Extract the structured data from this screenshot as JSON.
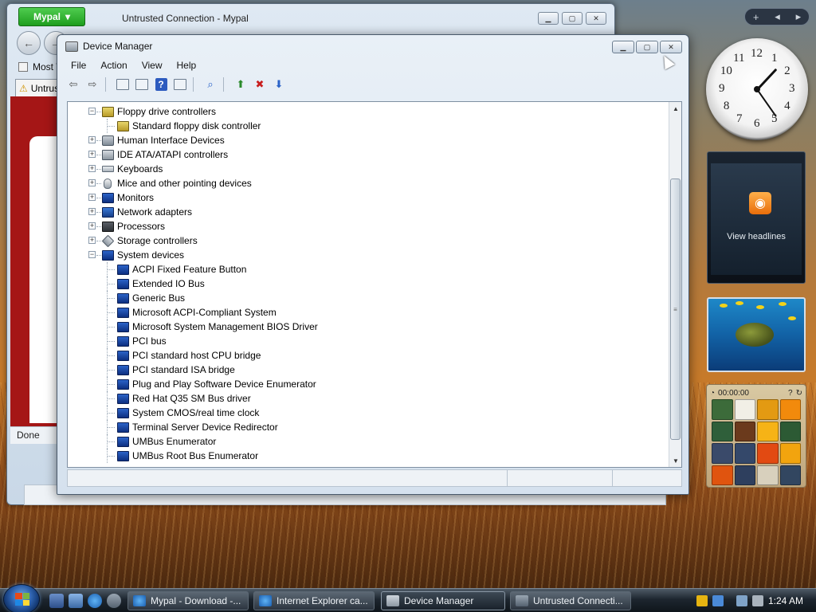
{
  "desktop": {
    "background_theme": "wheat-field"
  },
  "background_window": {
    "app_button": "Mypal",
    "title": "Untrusted Connection - Mypal",
    "bookmark": "Most V",
    "tab": "Untrus",
    "status": "Done"
  },
  "device_manager": {
    "title": "Device Manager",
    "menu": [
      "File",
      "Action",
      "View",
      "Help"
    ],
    "tree": [
      {
        "label": "Floppy drive controllers",
        "level": 0,
        "expanded": true,
        "icon": "floppy-controller-icon"
      },
      {
        "label": "Standard floppy disk controller",
        "level": 1,
        "icon": "floppy-controller-icon"
      },
      {
        "label": "Human Interface Devices",
        "level": 0,
        "expanded": false,
        "icon": "hid-icon"
      },
      {
        "label": "IDE ATA/ATAPI controllers",
        "level": 0,
        "expanded": false,
        "icon": "ide-icon"
      },
      {
        "label": "Keyboards",
        "level": 0,
        "expanded": false,
        "icon": "keyboard-icon"
      },
      {
        "label": "Mice and other pointing devices",
        "level": 0,
        "expanded": false,
        "icon": "mouse-icon"
      },
      {
        "label": "Monitors",
        "level": 0,
        "expanded": false,
        "icon": "monitor-icon"
      },
      {
        "label": "Network adapters",
        "level": 0,
        "expanded": false,
        "icon": "network-icon"
      },
      {
        "label": "Processors",
        "level": 0,
        "expanded": false,
        "icon": "processor-icon"
      },
      {
        "label": "Storage controllers",
        "level": 0,
        "expanded": false,
        "icon": "storage-icon"
      },
      {
        "label": "System devices",
        "level": 0,
        "expanded": true,
        "icon": "system-icon"
      },
      {
        "label": "ACPI Fixed Feature Button",
        "level": 1,
        "icon": "system-icon"
      },
      {
        "label": "Extended IO Bus",
        "level": 1,
        "icon": "system-icon"
      },
      {
        "label": "Generic Bus",
        "level": 1,
        "icon": "system-icon"
      },
      {
        "label": "Microsoft ACPI-Compliant System",
        "level": 1,
        "icon": "system-icon"
      },
      {
        "label": "Microsoft System Management BIOS Driver",
        "level": 1,
        "icon": "system-icon"
      },
      {
        "label": "PCI bus",
        "level": 1,
        "icon": "system-icon"
      },
      {
        "label": "PCI standard host CPU bridge",
        "level": 1,
        "icon": "system-icon"
      },
      {
        "label": "PCI standard ISA bridge",
        "level": 1,
        "icon": "system-icon"
      },
      {
        "label": "Plug and Play Software Device Enumerator",
        "level": 1,
        "icon": "system-icon"
      },
      {
        "label": "Red Hat Q35 SM Bus driver",
        "level": 1,
        "icon": "system-icon"
      },
      {
        "label": "System CMOS/real time clock",
        "level": 1,
        "icon": "system-icon"
      },
      {
        "label": "Terminal Server Device Redirector",
        "level": 1,
        "icon": "system-icon"
      },
      {
        "label": "UMBus Enumerator",
        "level": 1,
        "icon": "system-icon"
      },
      {
        "label": "UMBus Root Bus Enumerator",
        "level": 1,
        "icon": "system-icon"
      }
    ]
  },
  "sidebar": {
    "news_label": "View headlines",
    "timer": "00:00:00",
    "clock_numbers": [
      "12",
      "1",
      "2",
      "3",
      "4",
      "5",
      "6",
      "7",
      "8",
      "9",
      "10",
      "11"
    ]
  },
  "taskbar": {
    "tasks": [
      {
        "label": "Mypal - Download -...",
        "icon": "mypal-icon",
        "active": false
      },
      {
        "label": "Internet Explorer ca...",
        "icon": "ie-icon",
        "active": false
      },
      {
        "label": "Device Manager",
        "icon": "device-manager-icon",
        "active": true
      },
      {
        "label": "Untrusted Connecti...",
        "icon": "mypal-icon",
        "active": false
      }
    ],
    "time": "1:24 AM"
  },
  "colors": {
    "accent_blue": "#2b63c8",
    "mypal_green": "#1e9e1e",
    "error_red": "#a51616"
  }
}
